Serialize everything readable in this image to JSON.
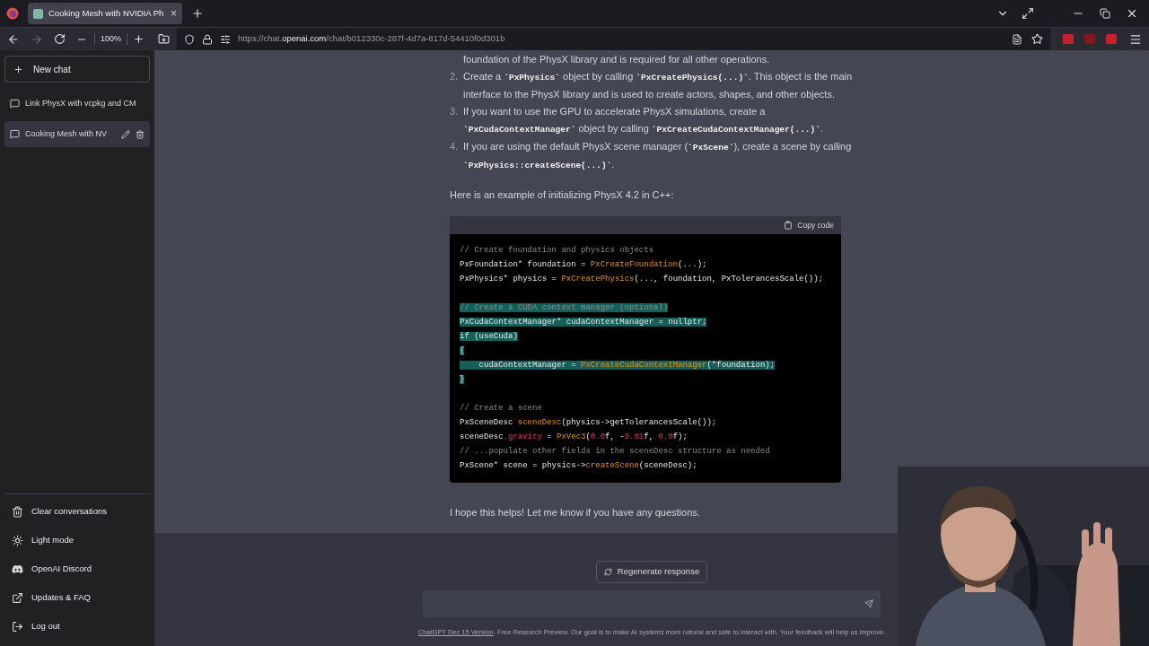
{
  "browser": {
    "tab": {
      "title": "Cooking Mesh with NVIDIA Ph",
      "close": "×",
      "selected": true
    },
    "zoom": "100%",
    "url": {
      "prefix": "https://chat.",
      "domain": "openai.com",
      "suffix": "/chat/b012330c-287f-4d7a-817d-54410f0d301b"
    },
    "forward_disabled": true
  },
  "sidebar": {
    "new_chat": "New chat",
    "chats": [
      {
        "title": "Link PhysX with vcpkg and CM",
        "selected": false
      },
      {
        "title": "Cooking Mesh with NV",
        "selected": true
      }
    ],
    "footer": [
      {
        "kind": "trash",
        "label": "Clear conversations"
      },
      {
        "kind": "sun",
        "label": "Light mode"
      },
      {
        "kind": "discord",
        "label": "OpenAI Discord"
      },
      {
        "kind": "external",
        "label": "Updates & FAQ"
      },
      {
        "kind": "logout",
        "label": "Log out"
      }
    ]
  },
  "message": {
    "continued_text": "foundation of the PhysX library and is required for all other operations.",
    "items": [
      {
        "number": "2.",
        "segments": [
          {
            "kind": "text",
            "text": "Create a "
          },
          {
            "kind": "code",
            "text": "`PxPhysics`"
          },
          {
            "kind": "text",
            "text": " object by calling "
          },
          {
            "kind": "code",
            "text": "`PxCreatePhysics(...)`"
          },
          {
            "kind": "text",
            "text": ". This object is the main interface to the PhysX library and is used to create actors, shapes, and other objects."
          }
        ]
      },
      {
        "number": "3.",
        "segments": [
          {
            "kind": "text",
            "text": "If you want to use the GPU to accelerate PhysX simulations, create a "
          },
          {
            "kind": "code",
            "text": "`PxCudaContextManager`"
          },
          {
            "kind": "text",
            "text": " object by calling "
          },
          {
            "kind": "code",
            "text": "`PxCreateCudaContextManager(...)`"
          },
          {
            "kind": "text",
            "text": "."
          }
        ]
      },
      {
        "number": "4.",
        "segments": [
          {
            "kind": "text",
            "text": "If you are using the default PhysX scene manager ("
          },
          {
            "kind": "code",
            "text": "`PxScene`"
          },
          {
            "kind": "text",
            "text": "), create a scene by calling "
          },
          {
            "kind": "code",
            "text": "`PxPhysics::createScene(...)`"
          },
          {
            "kind": "text",
            "text": "."
          }
        ]
      }
    ],
    "intro": "Here is an example of initializing PhysX 4.2 in C++:",
    "copy_code": "Copy code",
    "code_lines": [
      {
        "kind": "code",
        "selected": false,
        "tokens": [
          {
            "kind": "comment",
            "text": "// Create foundation and physics objects"
          }
        ]
      },
      {
        "kind": "code",
        "selected": false,
        "tokens": [
          {
            "kind": "plain",
            "text": "PxFoundation* foundation = "
          },
          {
            "kind": "func",
            "text": "PxCreateFoundation"
          },
          {
            "kind": "plain",
            "text": "(...);"
          }
        ]
      },
      {
        "kind": "code",
        "selected": false,
        "tokens": [
          {
            "kind": "plain",
            "text": "PxPhysics* physics = "
          },
          {
            "kind": "func",
            "text": "PxCreatePhysics"
          },
          {
            "kind": "plain",
            "text": "(..., foundation, PxTolerancesScale());"
          }
        ]
      },
      {
        "kind": "blank",
        "selected": false
      },
      {
        "kind": "code",
        "selected": true,
        "tokens": [
          {
            "kind": "comment",
            "text": "// Create a CUDA context manager (optional)"
          }
        ]
      },
      {
        "kind": "code",
        "selected": true,
        "tokens": [
          {
            "kind": "plain",
            "text": "PxCudaContextManager* cudaContextManager = nullptr;"
          }
        ]
      },
      {
        "kind": "code",
        "selected": true,
        "tokens": [
          {
            "kind": "plain",
            "text": "if (useCuda)"
          }
        ]
      },
      {
        "kind": "code",
        "selected": true,
        "tokens": [
          {
            "kind": "plain",
            "text": "{"
          }
        ]
      },
      {
        "kind": "code",
        "selected": true,
        "tokens": [
          {
            "kind": "plain",
            "text": "    cudaContextManager = "
          },
          {
            "kind": "func",
            "text": "PxCreateCudaContextManager"
          },
          {
            "kind": "plain",
            "text": "(*foundation);"
          }
        ]
      },
      {
        "kind": "code",
        "selected": true,
        "tokens": [
          {
            "kind": "plain",
            "text": "}"
          }
        ]
      },
      {
        "kind": "blank",
        "selected": false
      },
      {
        "kind": "code",
        "selected": false,
        "tokens": [
          {
            "kind": "comment",
            "text": "// Create a scene"
          }
        ]
      },
      {
        "kind": "code",
        "selected": false,
        "tokens": [
          {
            "kind": "plain",
            "text": "PxSceneDesc "
          },
          {
            "kind": "func",
            "text": "sceneDesc"
          },
          {
            "kind": "plain",
            "text": "(physics->getTolerancesScale());"
          }
        ]
      },
      {
        "kind": "code",
        "selected": false,
        "tokens": [
          {
            "kind": "plain",
            "text": "sceneDesc"
          },
          {
            "kind": "prop",
            "text": ".gravity"
          },
          {
            "kind": "plain",
            "text": " = "
          },
          {
            "kind": "func",
            "text": "PxVec3"
          },
          {
            "kind": "plain",
            "text": "("
          },
          {
            "kind": "num",
            "text": "0.0"
          },
          {
            "kind": "plain",
            "text": "f, -"
          },
          {
            "kind": "num",
            "text": "9.81"
          },
          {
            "kind": "plain",
            "text": "f, "
          },
          {
            "kind": "num",
            "text": "0.0"
          },
          {
            "kind": "plain",
            "text": "f);"
          }
        ]
      },
      {
        "kind": "code",
        "selected": false,
        "tokens": [
          {
            "kind": "comment",
            "text": "// ...populate other fields in the sceneDesc structure as needed"
          }
        ]
      },
      {
        "kind": "code",
        "selected": false,
        "tokens": [
          {
            "kind": "plain",
            "text": "PxScene* scene = physics->"
          },
          {
            "kind": "func",
            "text": "createScene"
          },
          {
            "kind": "plain",
            "text": "(sceneDesc);"
          }
        ]
      }
    ],
    "closing": "I hope this helps! Let me know if you have any questions."
  },
  "composer": {
    "regenerate": "Regenerate response",
    "footer_link": "ChatGPT Dec 15 Version",
    "footer_text": ". Free Research Preview. Our goal is to make AI systems more natural and safe to interact with. Your feedback will help us improve."
  }
}
